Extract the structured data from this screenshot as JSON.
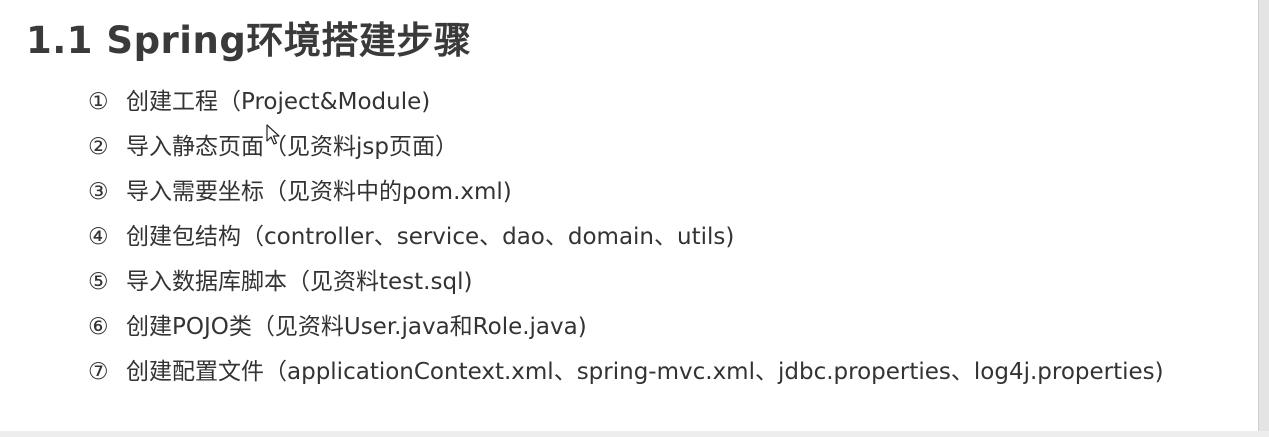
{
  "title": "1.1 Spring环境搭建步骤",
  "steps": [
    {
      "num": "①",
      "text": "创建工程（Project&Module)"
    },
    {
      "num": "②",
      "text": "导入静态页面（见资料jsp页面）"
    },
    {
      "num": "③",
      "text": "导入需要坐标（见资料中的pom.xml)"
    },
    {
      "num": "④",
      "text": "创建包结构（controller、service、dao、domain、utils)"
    },
    {
      "num": "⑤",
      "text": "导入数据库脚本（见资料test.sql)"
    },
    {
      "num": "⑥",
      "text": "创建POJO类（见资料User.java和Role.java)"
    },
    {
      "num": "⑦",
      "text": "创建配置文件（applicationContext.xml、spring-mvc.xml、jdbc.properties、log4j.properties)"
    }
  ],
  "icons": {
    "cursor": "mouse-pointer-icon"
  }
}
